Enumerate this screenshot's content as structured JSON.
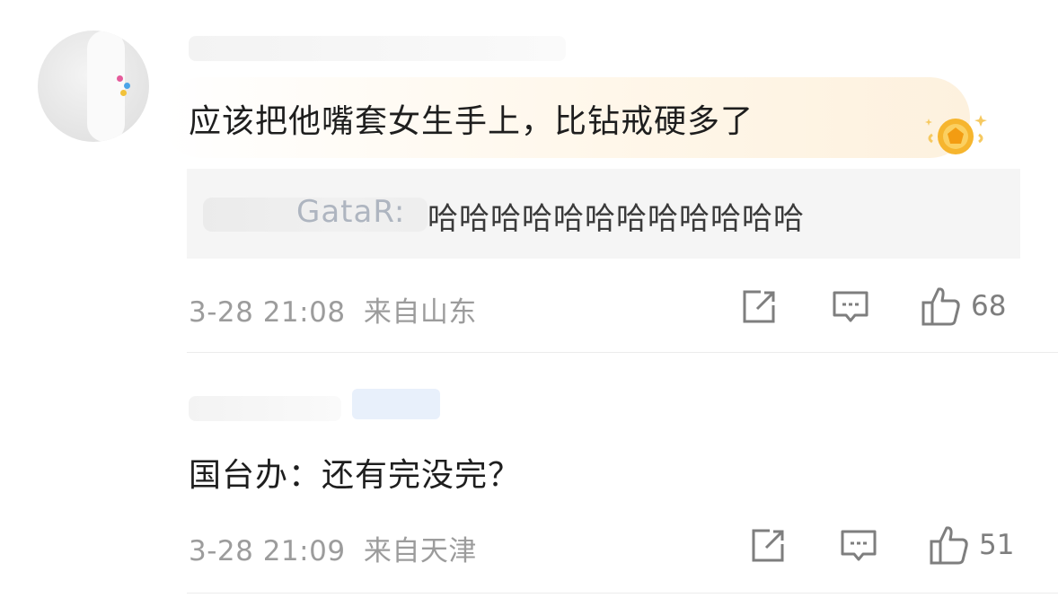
{
  "comments": [
    {
      "text": "应该把他嘴套女生手上，比钻戒硬多了",
      "reply": {
        "name": "GataR:",
        "text": "哈哈哈哈哈哈哈哈哈哈哈哈"
      },
      "time": "3-28 21:08",
      "location": "来自山东",
      "likes": "68"
    },
    {
      "text": "国台办：还有完没完？",
      "time": "3-28 21:09",
      "location": "来自天津",
      "likes": "51"
    }
  ],
  "icons": [
    "share-icon",
    "comment-icon",
    "like-icon",
    "badge-icon"
  ],
  "colors": {
    "badge": "#f6b52e",
    "meta": "#9c9c9c",
    "reply_bg": "#f5f5f5"
  }
}
